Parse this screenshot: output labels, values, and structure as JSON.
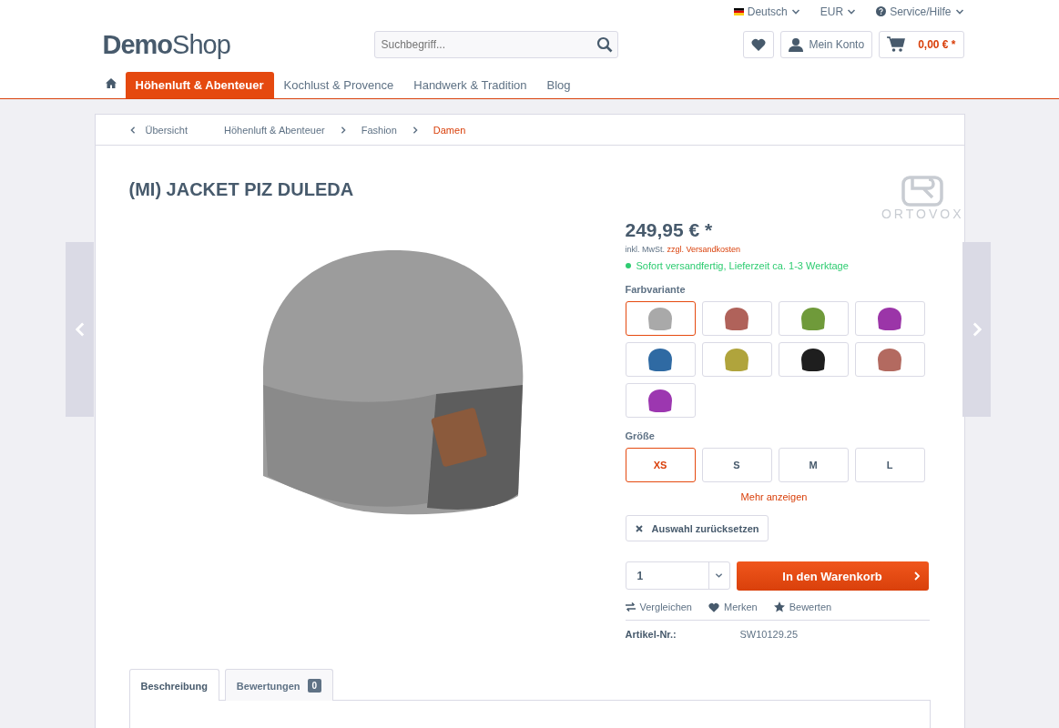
{
  "top_bar": {
    "language": "Deutsch",
    "currency": "EUR",
    "service": "Service/Hilfe"
  },
  "logo": "**Demo**Shop",
  "search": {
    "placeholder": "Suchbegriff..."
  },
  "account": {
    "label": "Mein Konto"
  },
  "cart": {
    "total": "0,00 € *"
  },
  "nav": [
    {
      "label": "Höhenluft & Abenteuer",
      "selected": true
    },
    {
      "label": "Kochlust & Provence",
      "selected": false
    },
    {
      "label": "Handwerk & Tradition",
      "selected": false
    },
    {
      "label": "Blog",
      "selected": false
    }
  ],
  "breadcrumb": {
    "back": "Übersicht",
    "items": [
      {
        "label": "Höhenluft & Abenteuer",
        "selected": false
      },
      {
        "label": "Fashion",
        "selected": false
      },
      {
        "label": "Damen",
        "selected": true
      }
    ]
  },
  "product": {
    "title": "(MI) JACKET PIZ DULEDA",
    "brand": "ORTOVOX",
    "price": "249,95 € *",
    "tax": "inkl. MwSt.",
    "shipping": "zzgl. Versandkosten",
    "delivery": "Sofort versandfertig, Lieferzeit ca. 1-3 Werktage"
  },
  "color_variants": {
    "label": "Farbvariante",
    "items": [
      {
        "color": "#a9a9a9",
        "selected": true
      },
      {
        "color": "#b0625a",
        "selected": false
      },
      {
        "color": "#6f9a3a",
        "selected": false
      },
      {
        "color": "#9b35a8",
        "selected": false
      },
      {
        "color": "#2f6aa3",
        "selected": false
      },
      {
        "color": "#b0a43c",
        "selected": false
      },
      {
        "color": "#1e1e1e",
        "selected": false
      },
      {
        "color": "#b36a60",
        "selected": false
      },
      {
        "color": "#9c37b0",
        "selected": false
      }
    ]
  },
  "sizes": {
    "label": "Größe",
    "items": [
      {
        "label": "XS",
        "selected": true
      },
      {
        "label": "S",
        "selected": false
      },
      {
        "label": "M",
        "selected": false
      },
      {
        "label": "L",
        "selected": false
      }
    ],
    "more": "Mehr anzeigen"
  },
  "reset": "Auswahl zurücksetzen",
  "quantity": "1",
  "add_to_cart": "In den Warenkorb",
  "actions": [
    {
      "kind": "compare",
      "label": "Vergleichen"
    },
    {
      "kind": "wishlist",
      "label": "Merken"
    },
    {
      "kind": "rate",
      "label": "Bewerten"
    }
  ],
  "article": {
    "label": "Artikel-Nr.:",
    "value": "SW10129.25"
  },
  "tabs": [
    {
      "label": "Beschreibung",
      "selected": true
    },
    {
      "label": "Bewertungen",
      "selected": false,
      "count": "0"
    }
  ]
}
